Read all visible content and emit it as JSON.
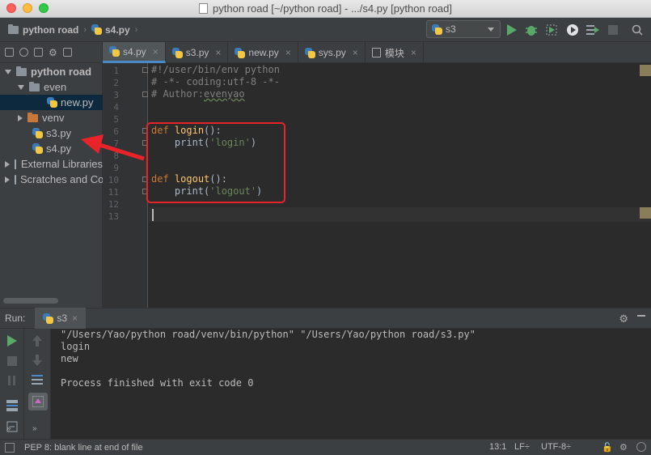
{
  "window": {
    "title": "python road [~/python road] - .../s4.py [python road]"
  },
  "navbar": {
    "project": "python road",
    "file": "s4.py"
  },
  "run_config": {
    "name": "s3"
  },
  "project_tree": [
    {
      "label": "python road",
      "type": "project",
      "expanded": true
    },
    {
      "label": "even",
      "type": "folder",
      "expanded": true
    },
    {
      "label": "new.py",
      "type": "file",
      "selected": true
    },
    {
      "label": "venv",
      "type": "folder-orange",
      "expanded": false
    },
    {
      "label": "s3.py",
      "type": "file"
    },
    {
      "label": "s4.py",
      "type": "file"
    },
    {
      "label": "External Libraries",
      "type": "library"
    },
    {
      "label": "Scratches and Consoles",
      "type": "scratch"
    }
  ],
  "tabs": [
    {
      "label": "s4.py",
      "active": true
    },
    {
      "label": "s3.py"
    },
    {
      "label": "new.py"
    },
    {
      "label": "sys.py"
    },
    {
      "label": "模块"
    }
  ],
  "editor": {
    "line_numbers": [
      "1",
      "2",
      "3",
      "4",
      "5",
      "6",
      "7",
      "8",
      "9",
      "10",
      "11",
      "12",
      "13"
    ],
    "lines": {
      "l1": "#!/user/bin/env python",
      "l2": "# -*- coding:utf-8 -*-",
      "l3_prefix": "# Author:",
      "l3_author": "evenyao",
      "l6_kw": "def",
      "l6_fn": "login",
      "l6_rest": "():",
      "l7_call": "    print(",
      "l7_str": "'login'",
      "l7_end": ")",
      "l10_kw": "def",
      "l10_fn": "logout",
      "l10_rest": "():",
      "l11_call": "    print(",
      "l11_str": "'logout'",
      "l11_end": ")"
    }
  },
  "run_panel": {
    "label": "Run:",
    "tab": "s3",
    "output": [
      "\"/Users/Yao/python road/venv/bin/python\" \"/Users/Yao/python road/s3.py\"",
      "login",
      "new",
      "",
      "Process finished with exit code 0"
    ]
  },
  "status_bar": {
    "message": "PEP 8: blank line at end of file",
    "position": "13:1",
    "line_sep": "LF÷",
    "encoding": "UTF-8÷"
  },
  "colors": {
    "highlight_box": "#e8242a",
    "active_tab_underline": "#4a88c7"
  }
}
